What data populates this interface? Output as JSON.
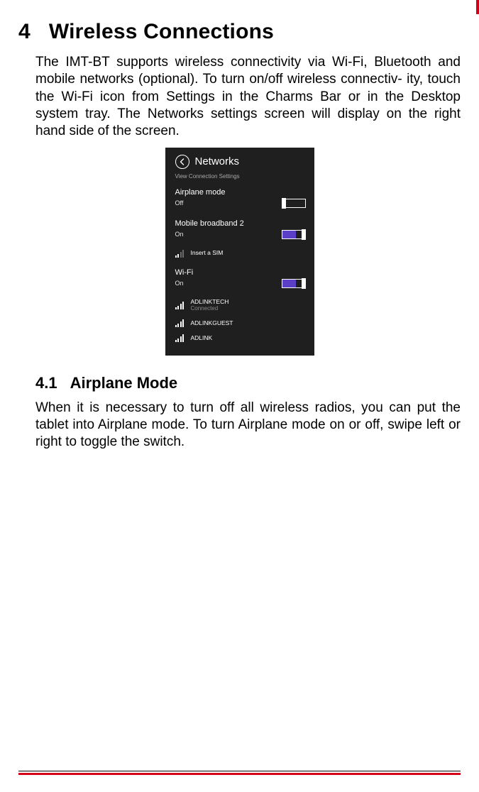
{
  "heading": {
    "num": "4",
    "title": "Wireless Connections"
  },
  "intro": "The IMT-BT supports wireless connectivity via Wi-Fi, Bluetooth and mobile networks (optional). To turn on/off wireless connectiv- ity, touch the Wi-Fi icon from Settings in the Charms Bar or in the Desktop system tray. The Networks settings screen will display on the right hand side of the screen.",
  "panel": {
    "title": "Networks",
    "link": "View Connection Settings",
    "airplane": {
      "label": "Airplane mode",
      "state": "Off"
    },
    "mobile": {
      "label": "Mobile broadband 2",
      "state": "On",
      "item": "Insert a SIM"
    },
    "wifi": {
      "label": "Wi-Fi",
      "state": "On",
      "networks": [
        {
          "name": "ADLINKTECH",
          "sub": "Connected"
        },
        {
          "name": "ADLINKGUEST",
          "sub": ""
        },
        {
          "name": "ADLINK",
          "sub": ""
        }
      ]
    }
  },
  "sub": {
    "num": "4.1",
    "title": "Airplane Mode"
  },
  "subpara": "When it is necessary to turn off all wireless radios, you can put the tablet into Airplane mode. To turn Airplane mode on or off, swipe left or right to toggle the switch."
}
